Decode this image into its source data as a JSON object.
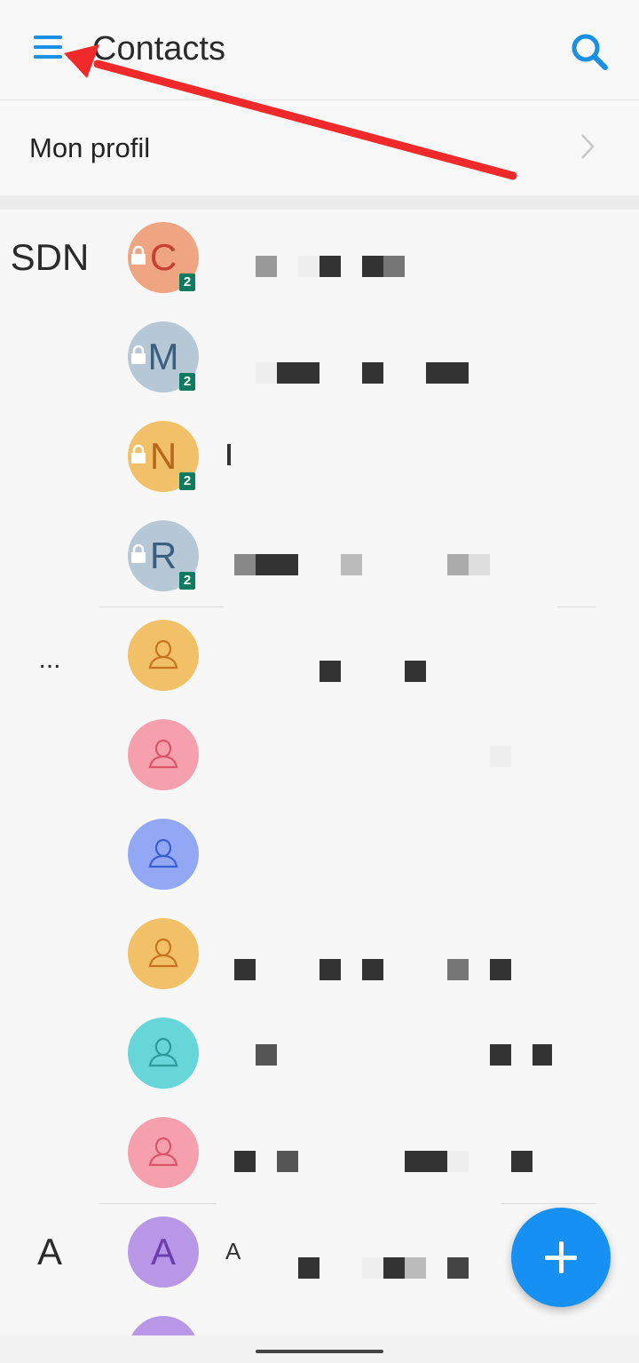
{
  "header": {
    "title": "Contacts",
    "menu_icon": "menu-icon",
    "search_icon": "search-icon",
    "accent": "#1a8fe6"
  },
  "profile": {
    "label": "Mon profil"
  },
  "sections": {
    "sdn": "SDN",
    "ellipsis": "...",
    "a": "A"
  },
  "sim_contacts": [
    {
      "initial": "C",
      "bg": "#f0a582",
      "fg": "#c8402f",
      "sim": "2"
    },
    {
      "initial": "M",
      "bg": "#b6c7d6",
      "fg": "#3a5f80",
      "sim": "2"
    },
    {
      "initial": "N",
      "bg": "#f1c068",
      "fg": "#b8661c",
      "sim": "2"
    },
    {
      "initial": "R",
      "bg": "#b6c7d6",
      "fg": "#3a5f80",
      "sim": "2"
    }
  ],
  "contacts": [
    {
      "bg": "#f2c067",
      "fg": "#c77420"
    },
    {
      "bg": "#f6a0ad",
      "fg": "#d9566a"
    },
    {
      "bg": "#92a8f5",
      "fg": "#3d5ed0"
    },
    {
      "bg": "#f2c067",
      "fg": "#c77420"
    },
    {
      "bg": "#66d6d8",
      "fg": "#2a9b98"
    },
    {
      "bg": "#f6a0ad",
      "fg": "#d9566a"
    }
  ],
  "a_contacts": [
    {
      "initial": "A",
      "bg": "#b898e6",
      "fg": "#6a3db0",
      "name_start": "A"
    }
  ],
  "fab_icon": "add-icon"
}
